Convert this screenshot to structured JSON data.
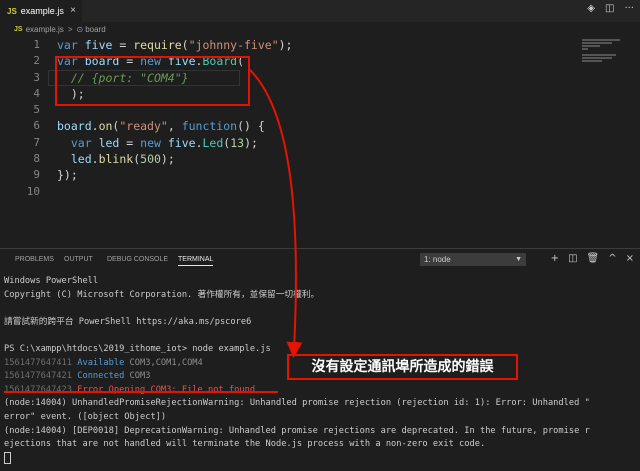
{
  "tab": {
    "icon": "JS",
    "name": "example.js",
    "close": "×"
  },
  "tab_actions": {
    "diff": "◈",
    "split": "◫",
    "more": "···"
  },
  "breadcrumb": {
    "file": "example.js",
    "sep": ">",
    "symbol_icon": "⊙",
    "symbol": "board"
  },
  "editor": {
    "line_numbers": [
      "1",
      "2",
      "3",
      "4",
      "5",
      "6",
      "7",
      "8",
      "9",
      "10"
    ]
  },
  "panel": {
    "tabs": [
      "PROBLEMS",
      "OUTPUT",
      "DEBUG CONSOLE",
      "TERMINAL"
    ],
    "active_tab": "TERMINAL",
    "terminal_select": "1: node",
    "icons": {
      "add": "+",
      "split": "◫",
      "trash": "🗑",
      "maximize": "^",
      "close": "×"
    }
  },
  "terminal": {
    "l1": "Windows PowerShell",
    "l2": "Copyright (C) Microsoft Corporation. 著作權所有，並保留一切權利。",
    "l3": "請嘗試新的跨平台 PowerShell https://aka.ms/pscore6",
    "prompt": "PS C:\\xampp\\htdocs\\2019_ithome_iot> node example.js",
    "r1_ts": "1561477647411",
    "r1_label": "Available",
    "r1_val": "COM3,COM1,COM4",
    "r2_ts": "1561477647421",
    "r2_label": "Connected",
    "r2_val": "COM3",
    "r3_ts": "1561477647423",
    "r3_label": "Error",
    "r3_val": "Opening COM3: File not found",
    "w1": "(node:14004) UnhandledPromiseRejectionWarning: Unhandled promise rejection (rejection id: 1): Error: Unhandled \"",
    "w2": "error\" event. ([object Object])",
    "w3": "(node:14004) [DEP0018] DeprecationWarning: Unhandled promise rejections are deprecated. In the future, promise r",
    "w4": "ejections that are not handled will terminate the Node.js process with a non-zero exit code."
  },
  "annotation": "沒有設定通訊埠所造成的錯誤",
  "colors": {
    "annotation_red": "#e51400",
    "editor_bg": "#1e1e1e"
  }
}
